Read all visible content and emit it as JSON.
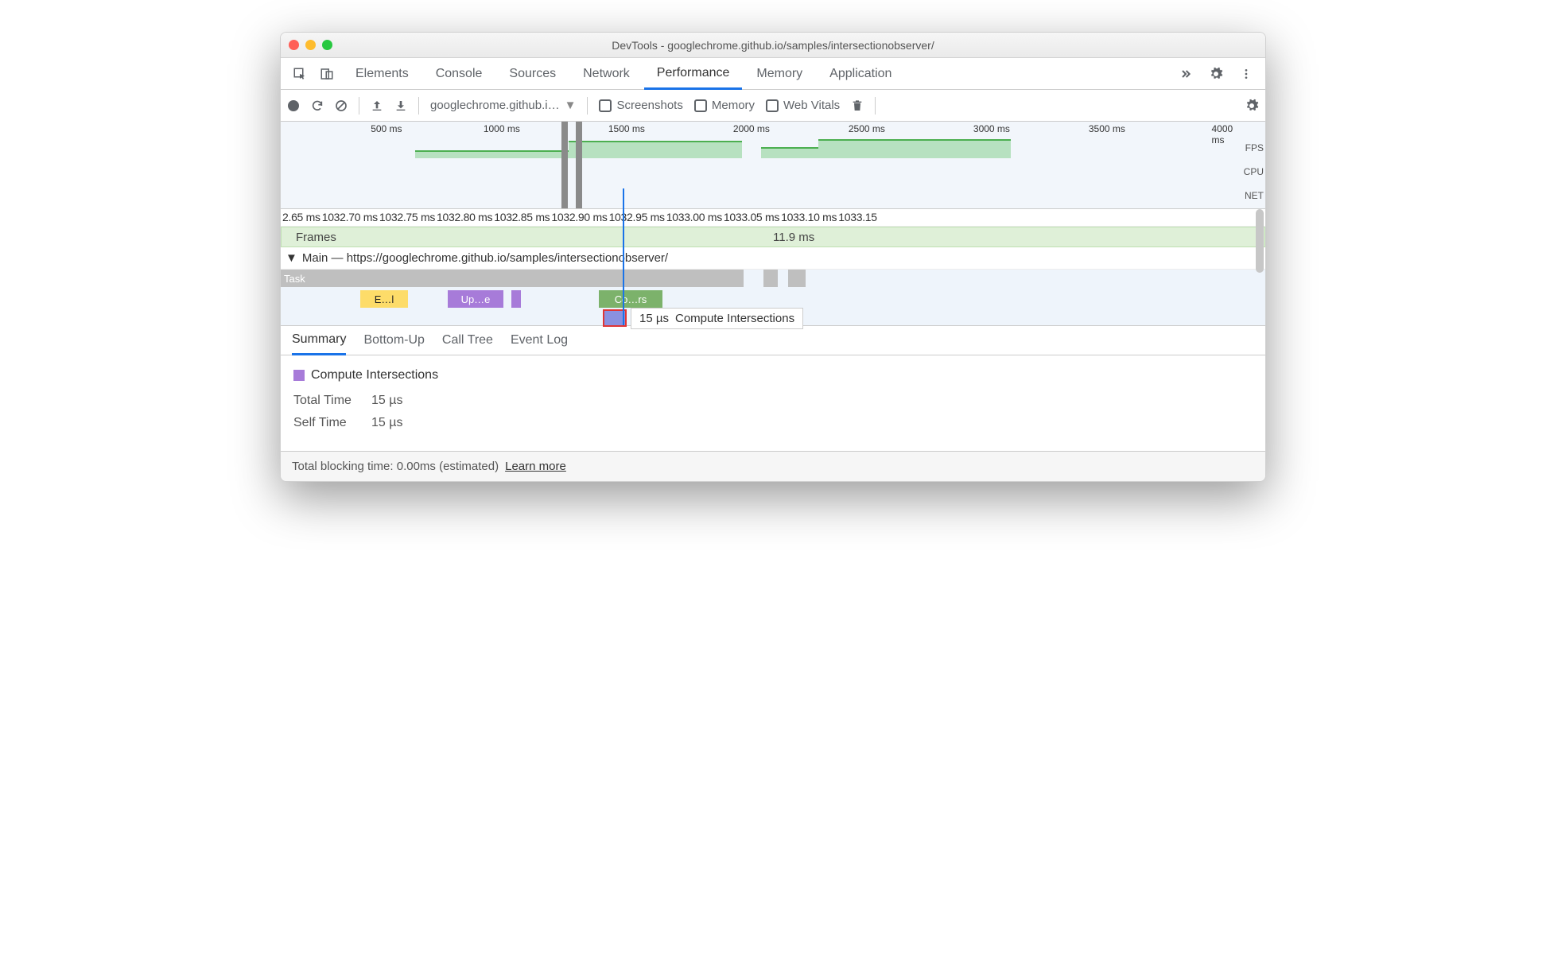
{
  "window": {
    "title": "DevTools - googlechrome.github.io/samples/intersectionobserver/"
  },
  "tabs": {
    "items": [
      "Elements",
      "Console",
      "Sources",
      "Network",
      "Performance",
      "Memory",
      "Application"
    ],
    "active": "Performance"
  },
  "toolbar": {
    "source": "googlechrome.github.i…",
    "screenshots": "Screenshots",
    "memory": "Memory",
    "webvitals": "Web Vitals"
  },
  "overview": {
    "ticks": [
      "500 ms",
      "1000 ms",
      "1500 ms",
      "2000 ms",
      "2500 ms",
      "3000 ms",
      "3500 ms",
      "4000 ms"
    ],
    "lanes": [
      "FPS",
      "CPU",
      "NET"
    ]
  },
  "ruler": [
    "2.65 ms",
    "1032.70 ms",
    "1032.75 ms",
    "1032.80 ms",
    "1032.85 ms",
    "1032.90 ms",
    "1032.95 ms",
    "1033.00 ms",
    "1033.05 ms",
    "1033.10 ms",
    "1033.15"
  ],
  "flame": {
    "frames_label": "Frames",
    "frame_time": "11.9 ms",
    "main_label": "Main — https://googlechrome.github.io/samples/intersectionobserver/",
    "task": "Task",
    "ev_yellow": "E…l",
    "ev_purple": "Up…e",
    "ev_green": "Co…rs",
    "tooltip_time": "15 µs",
    "tooltip_name": "Compute Intersections"
  },
  "detail_tabs": [
    "Summary",
    "Bottom-Up",
    "Call Tree",
    "Event Log"
  ],
  "summary": {
    "name": "Compute Intersections",
    "total_label": "Total Time",
    "total_value": "15 µs",
    "self_label": "Self Time",
    "self_value": "15 µs"
  },
  "footer": {
    "text": "Total blocking time: 0.00ms (estimated)",
    "link": "Learn more"
  },
  "chart_data": {
    "type": "timeline",
    "overview_range_ms": [
      0,
      4000
    ],
    "detail_range_ms": [
      1032.65,
      1033.15
    ],
    "frame_duration_ms": 11.9,
    "selected_event": {
      "name": "Compute Intersections",
      "total_us": 15,
      "self_us": 15
    }
  }
}
